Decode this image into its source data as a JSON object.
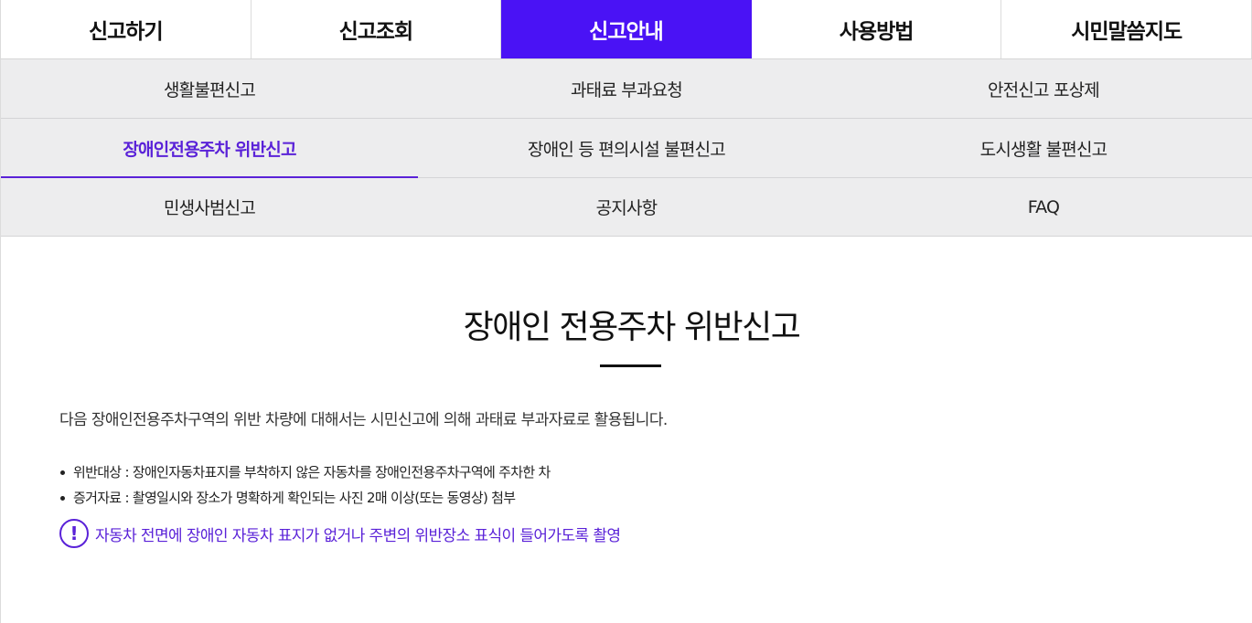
{
  "main_nav": {
    "tabs": [
      {
        "label": "신고하기"
      },
      {
        "label": "신고조회"
      },
      {
        "label": "신고안내"
      },
      {
        "label": "사용방법"
      },
      {
        "label": "시민말씀지도"
      }
    ],
    "active_index": 2
  },
  "sub_nav": {
    "rows": [
      [
        "생활불편신고",
        "과태료 부과요청",
        "안전신고 포상제"
      ],
      [
        "장애인전용주차 위반신고",
        "장애인 등 편의시설 불편신고",
        "도시생활 불편신고"
      ],
      [
        "민생사범신고",
        "공지사항",
        "FAQ"
      ]
    ],
    "active": "장애인전용주차 위반신고"
  },
  "content": {
    "title": "장애인 전용주차 위반신고",
    "intro": "다음 장애인전용주차구역의 위반 차량에 대해서는 시민신고에 의해 과태료 부과자료로 활용됩니다.",
    "bullets": [
      "위반대상 : 장애인자동차표지를 부착하지 않은 자동차를 장애인전용주차구역에 주차한 차",
      "증거자료 : 촬영일시와 장소가 명확하게 확인되는 사진 2매 이상(또는 동영상) 첨부"
    ],
    "notice": {
      "icon": "exclamation-circle-icon",
      "symbol": "!",
      "text": "자동차 전면에 장애인 자동차 표지가 없거나 주변의 위반장소 표식이 들어가도록 촬영"
    }
  },
  "colors": {
    "accent": "#4a12f5",
    "accent_text": "#5a22d8",
    "subnav_bg": "#ededee",
    "top_strip": "#3cbcb4"
  }
}
